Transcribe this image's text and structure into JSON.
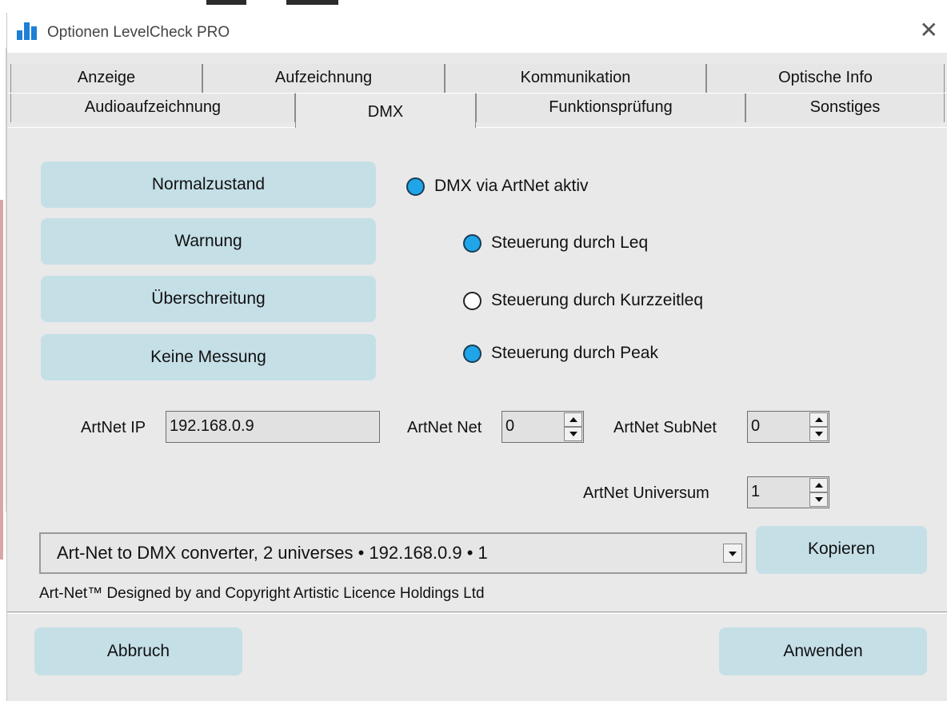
{
  "window": {
    "title": "Optionen LevelCheck PRO",
    "close_glyph": "✕",
    "app_icon": "bar-chart-icon",
    "accent_color": "#1e7fd6"
  },
  "tabs": {
    "row1": [
      "Anzeige",
      "Aufzeichnung",
      "Kommunikation",
      "Optische Info"
    ],
    "row2": [
      "Audioaufzeichnung",
      "DMX",
      "Funktionsprüfung",
      "Sonstiges"
    ],
    "active": "DMX"
  },
  "state_buttons": [
    "Normalzustand",
    "Warnung",
    "Überschreitung",
    "Keine Messung"
  ],
  "radios": {
    "dmx_active": {
      "label": "DMX via ArtNet aktiv",
      "checked": true
    },
    "leq": {
      "label": "Steuerung durch Leq",
      "checked": true
    },
    "kurzzeitleq": {
      "label": "Steuerung durch Kurzzeitleq",
      "checked": false
    },
    "peak": {
      "label": "Steuerung durch Peak",
      "checked": true
    }
  },
  "artnet": {
    "ip_label": "ArtNet IP",
    "ip_value": "192.168.0.9",
    "net_label": "ArtNet Net",
    "net_value": "0",
    "subnet_label": "ArtNet SubNet",
    "subnet_value": "0",
    "universe_label": "ArtNet Universum",
    "universe_value": "1"
  },
  "device_select": {
    "value": "Art-Net to DMX converter, 2 universes • 192.168.0.9 • 1"
  },
  "copy_button": "Kopieren",
  "copyright": "Art-Net™ Designed by and Copyright Artistic Licence Holdings Ltd",
  "footer": {
    "cancel": "Abbruch",
    "apply": "Anwenden"
  },
  "colors": {
    "button_bg": "#c5dfe7",
    "radio_on": "#1fa5e8",
    "dialog_bg": "#e9e9e9"
  }
}
